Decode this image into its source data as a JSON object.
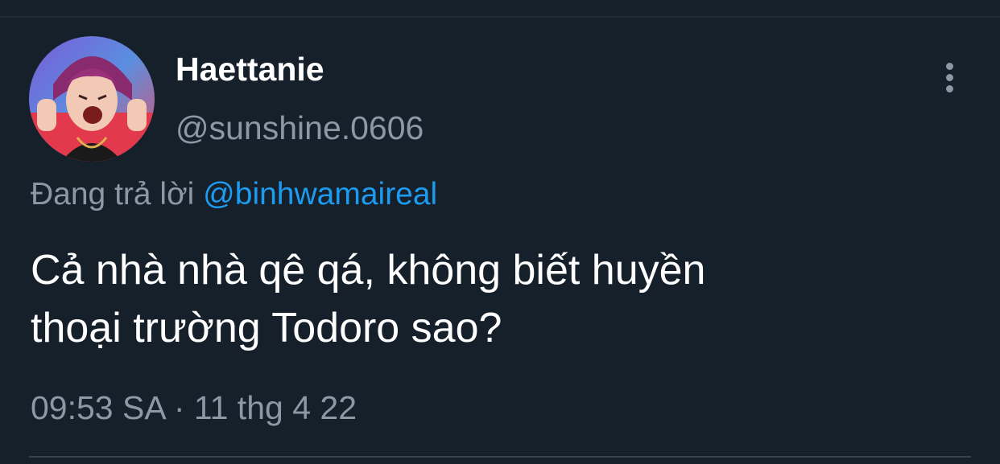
{
  "tweet": {
    "author": {
      "display_name": "Haettanie",
      "handle": "@sunshine.0606",
      "avatar": "profile-photo"
    },
    "reply": {
      "prefix": "Đang trả lời",
      "mention": "@binhwamaireal"
    },
    "text_line_1": "Cả nhà nhà qê qá, không biết huyền",
    "text_line_2": "thoại trường Todoro sao?",
    "timestamp": "09:53 SA · 11 thg 4 22",
    "more_icon": "more-vertical-icon"
  },
  "colors": {
    "background": "#15202b",
    "primary_text": "#ffffff",
    "secondary_text": "#8b98a5",
    "link": "#1d9bf0",
    "divider": "#38444d"
  }
}
